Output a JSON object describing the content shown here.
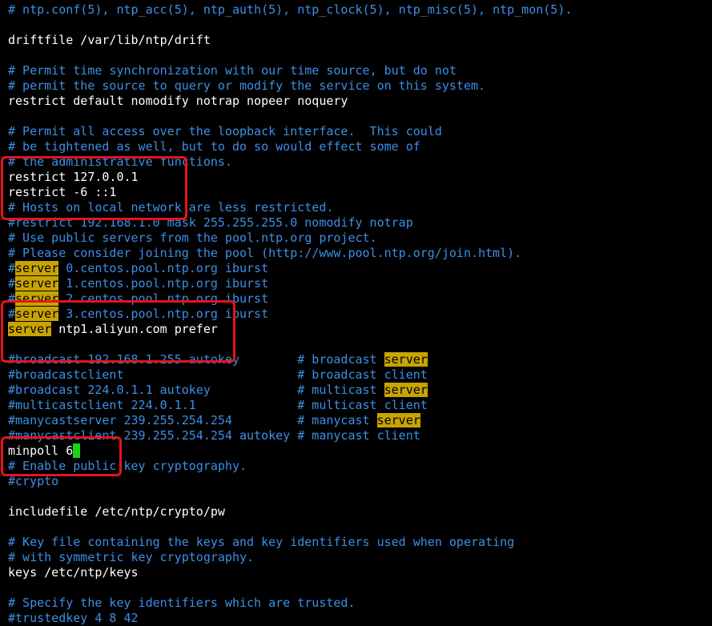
{
  "terminal": {
    "lines": [
      {
        "kind": "comment",
        "text": "# ntp.conf(5), ntp_acc(5), ntp_auth(5), ntp_clock(5), ntp_misc(5), ntp_mon(5)."
      },
      {
        "kind": "blank",
        "text": ""
      },
      {
        "kind": "plain",
        "text": "driftfile /var/lib/ntp/drift"
      },
      {
        "kind": "blank",
        "text": ""
      },
      {
        "kind": "comment",
        "text": "# Permit time synchronization with our time source, but do not"
      },
      {
        "kind": "comment",
        "text": "# permit the source to query or modify the service on this system."
      },
      {
        "kind": "plain",
        "text": "restrict default nomodify notrap nopeer noquery"
      },
      {
        "kind": "blank",
        "text": ""
      },
      {
        "kind": "comment",
        "text": "# Permit all access over the loopback interface.  This could"
      },
      {
        "kind": "comment",
        "text": "# be tightened as well, but to do so would effect some of"
      },
      {
        "kind": "comment",
        "text": "# the administrative functions."
      },
      {
        "kind": "plain",
        "text": "restrict 127.0.0.1"
      },
      {
        "kind": "plain",
        "text": "restrict -6 ::1"
      },
      {
        "kind": "comment",
        "text": "# Hosts on local network are less restricted."
      },
      {
        "kind": "comment",
        "text": "#restrict 192.168.1.0 mask 255.255.255.0 nomodify notrap"
      },
      {
        "kind": "comment",
        "text": "# Use public servers from the pool.ntp.org project."
      },
      {
        "kind": "comment",
        "text": "# Please consider joining the pool (http://www.pool.ntp.org/join.html)."
      },
      {
        "kind": "server_commented",
        "prefix": "#",
        "keyword": "server",
        "rest": " 0.centos.pool.ntp.org iburst"
      },
      {
        "kind": "server_commented",
        "prefix": "#",
        "keyword": "server",
        "rest": " 1.centos.pool.ntp.org iburst"
      },
      {
        "kind": "server_commented",
        "prefix": "#",
        "keyword": "server",
        "rest": " 2.centos.pool.ntp.org iburst"
      },
      {
        "kind": "server_commented",
        "prefix": "#",
        "keyword": "server",
        "rest": " 3.centos.pool.ntp.org iburst"
      },
      {
        "kind": "server_active",
        "prefix": "",
        "keyword": "server",
        "rest": " ntp1.aliyun.com prefer"
      },
      {
        "kind": "blank",
        "text": ""
      },
      {
        "kind": "comment_hl_tail",
        "text": "#broadcast 192.168.1.255 autokey        # broadcast ",
        "hl": "server"
      },
      {
        "kind": "comment",
        "text": "#broadcastclient                        # broadcast client"
      },
      {
        "kind": "comment_hl_tail",
        "text": "#broadcast 224.0.1.1 autokey            # multicast ",
        "hl": "server"
      },
      {
        "kind": "comment",
        "text": "#multicastclient 224.0.1.1              # multicast client"
      },
      {
        "kind": "comment_hl_tail",
        "text": "#manycastserver 239.255.254.254         # manycast ",
        "hl": "server"
      },
      {
        "kind": "comment",
        "text": "#manycastclient 239.255.254.254 autokey # manycast client"
      },
      {
        "kind": "cursor_line",
        "text": "minpoll 6",
        "cursor": " "
      },
      {
        "kind": "comment",
        "text": "# Enable public key cryptography."
      },
      {
        "kind": "comment",
        "text": "#crypto"
      },
      {
        "kind": "blank",
        "text": ""
      },
      {
        "kind": "plain",
        "text": "includefile /etc/ntp/crypto/pw"
      },
      {
        "kind": "blank",
        "text": ""
      },
      {
        "kind": "comment",
        "text": "# Key file containing the keys and key identifiers used when operating"
      },
      {
        "kind": "comment",
        "text": "# with symmetric key cryptography."
      },
      {
        "kind": "plain",
        "text": "keys /etc/ntp/keys"
      },
      {
        "kind": "blank",
        "text": ""
      },
      {
        "kind": "comment",
        "text": "# Specify the key identifiers which are trusted."
      },
      {
        "kind": "comment",
        "text": "#trustedkey 4 8 42"
      }
    ]
  },
  "colors": {
    "background": "#000000",
    "comment": "#3c8fe6",
    "text": "#ffffff",
    "search_highlight": "#c8a400",
    "cursor": "#19d419",
    "annotation_box": "#e4141a"
  }
}
